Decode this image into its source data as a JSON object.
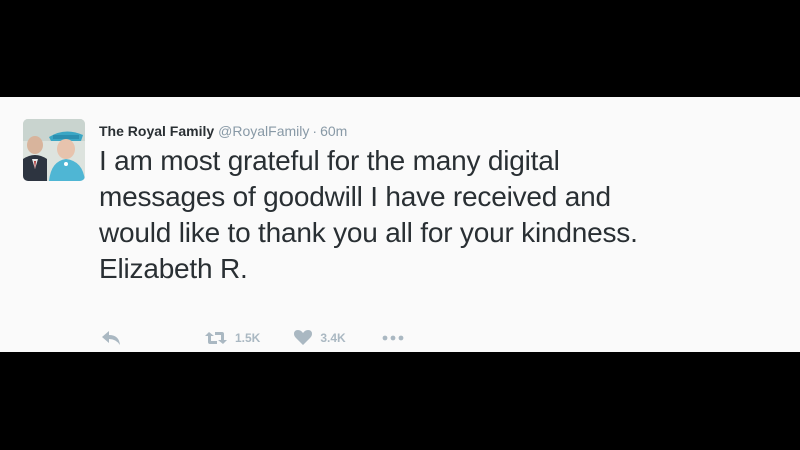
{
  "tweet": {
    "author_name": "The Royal Family",
    "author_handle": "@RoyalFamily",
    "separator": "·",
    "timestamp": "60m",
    "text_lines": [
      "I am most grateful for the many digital",
      "messages of goodwill I have received and",
      "would like to thank you all for your kindness.",
      "Elizabeth R."
    ],
    "retweet_count": "1.5K",
    "like_count": "3.4K"
  },
  "icons": {
    "reply": "reply-arrow-icon",
    "retweet": "retweet-icon",
    "like": "heart-icon",
    "more": "more-dots-icon"
  },
  "colors": {
    "background": "#000000",
    "card": "#fafafa",
    "text": "#292f33",
    "muted": "#8899a6",
    "action": "#aab8c2"
  }
}
